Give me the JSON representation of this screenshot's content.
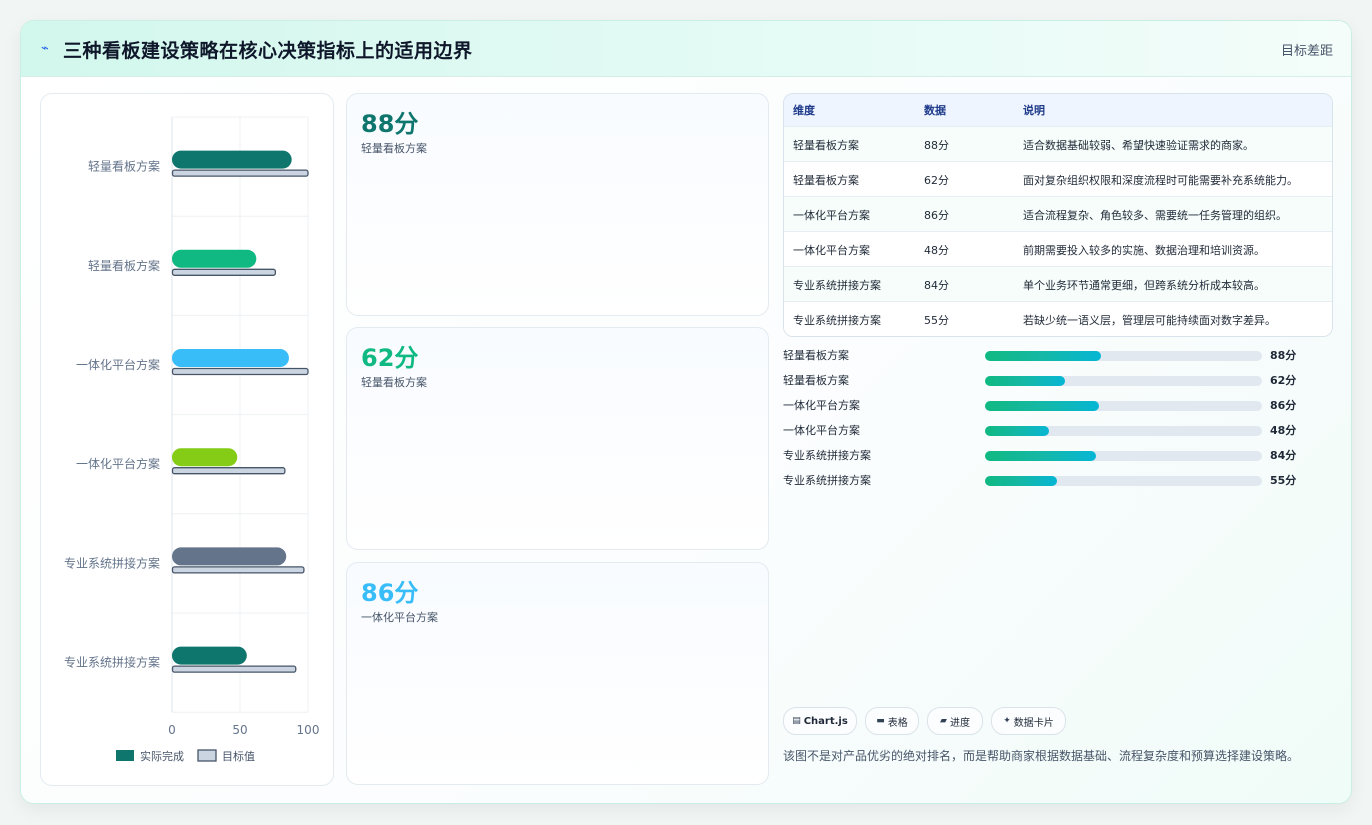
{
  "header": {
    "icon": "sparkle-icon",
    "title": "三种看板建设策略在核心决策指标上的适用边界",
    "link": "目标差距"
  },
  "chart_data": {
    "type": "bar",
    "orientation": "horizontal",
    "categories": [
      "轻量看板方案",
      "轻量看板方案",
      "一体化平台方案",
      "一体化平台方案",
      "专业系统拼接方案",
      "专业系统拼接方案"
    ],
    "series": [
      {
        "name": "实际完成",
        "values": [
          88,
          62,
          86,
          48,
          84,
          55
        ],
        "colors": [
          "#0f766e",
          "#10b981",
          "#38bdf8",
          "#84cc16",
          "#64748b",
          "#0f766e"
        ]
      },
      {
        "name": "目标值",
        "values": [
          100,
          76,
          100,
          83,
          97,
          91
        ],
        "color": "#cbd5e1",
        "stroke": "#475569"
      }
    ],
    "xlim": [
      0,
      100
    ],
    "xticks": [
      "0",
      "50",
      "100"
    ],
    "grid": true,
    "legend": "bottom"
  },
  "kpis": [
    {
      "value": "88分",
      "label": "轻量看板方案",
      "color": "#0f766e"
    },
    {
      "value": "62分",
      "label": "轻量看板方案",
      "color": "#10b981"
    },
    {
      "value": "86分",
      "label": "一体化平台方案",
      "color": "#38bdf8"
    }
  ],
  "table": {
    "headers": [
      "维度",
      "数据",
      "说明"
    ],
    "rows": [
      [
        "轻量看板方案",
        "88分",
        "适合数据基础较弱、希望快速验证需求的商家。"
      ],
      [
        "轻量看板方案",
        "62分",
        "面对复杂组织权限和深度流程时可能需要补充系统能力。"
      ],
      [
        "一体化平台方案",
        "86分",
        "适合流程复杂、角色较多、需要统一任务管理的组织。"
      ],
      [
        "一体化平台方案",
        "48分",
        "前期需要投入较多的实施、数据治理和培训资源。"
      ],
      [
        "专业系统拼接方案",
        "84分",
        "单个业务环节通常更细，但跨系统分析成本较高。"
      ],
      [
        "专业系统拼接方案",
        "55分",
        "若缺少统一语义层，管理层可能持续面对数字差异。"
      ]
    ]
  },
  "progress": [
    {
      "label": "轻量看板方案",
      "value": "88分",
      "fraction": 0.42
    },
    {
      "label": "轻量看板方案",
      "value": "62分",
      "fraction": 0.29
    },
    {
      "label": "一体化平台方案",
      "value": "86分",
      "fraction": 0.41
    },
    {
      "label": "一体化平台方案",
      "value": "48分",
      "fraction": 0.23
    },
    {
      "label": "专业系统拼接方案",
      "value": "84分",
      "fraction": 0.4
    },
    {
      "label": "专业系统拼接方案",
      "value": "55分",
      "fraction": 0.26
    }
  ],
  "chips": [
    {
      "icon": "chart-icon",
      "text": "Chart.js"
    },
    {
      "icon": "table-icon",
      "text": "表格"
    },
    {
      "icon": "progress-icon",
      "text": "进度"
    },
    {
      "icon": "card-icon",
      "text": "数据卡片"
    }
  ],
  "note": "该图不是对产品优劣的绝对排名，而是帮助商家根据数据基础、流程复杂度和预算选择建设策略。"
}
